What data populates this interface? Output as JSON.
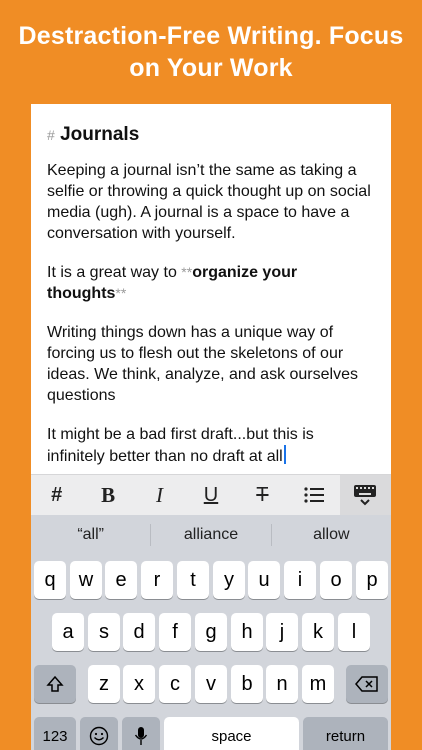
{
  "headline": {
    "line1": "Destraction-Free Writing.  Focus",
    "line2": "on Your Work"
  },
  "editor": {
    "heading_marker": "#",
    "heading": "Journals",
    "para1": "Keeping a journal isn’t the same as taking a selfie or throwing a quick thought up on social media (ugh).  A journal is a space to have a conversation with yourself.",
    "para2_pre": "It is a great way to ",
    "para2_mark": "**",
    "para2_bold": "organize your thoughts",
    "para3": "Writing things down has a unique way of forcing us to flesh out the skeletons of our ideas.  We think, analyze, and ask ourselves questions",
    "para4": "It might be a bad first draft...but this is infinitely better than no draft at all"
  },
  "toolbar": {
    "items": [
      {
        "label": "#",
        "icon": "heading-icon"
      },
      {
        "label": "B",
        "icon": "bold-icon"
      },
      {
        "label": "I",
        "icon": "italic-icon"
      },
      {
        "label": "U",
        "icon": "underline-icon"
      },
      {
        "label": "T",
        "icon": "strikethrough-icon"
      },
      {
        "icon": "list-icon"
      },
      {
        "icon": "keyboard-dismiss-icon"
      }
    ]
  },
  "keyboard": {
    "suggestions": [
      "“all”",
      "alliance",
      "allow"
    ],
    "row1": [
      "q",
      "w",
      "e",
      "r",
      "t",
      "y",
      "u",
      "i",
      "o",
      "p"
    ],
    "row2": [
      "a",
      "s",
      "d",
      "f",
      "g",
      "h",
      "j",
      "k",
      "l"
    ],
    "row3": [
      "z",
      "x",
      "c",
      "v",
      "b",
      "n",
      "m"
    ],
    "numbers_label": "123",
    "space_label": "space",
    "return_label": "return"
  },
  "colors": {
    "background": "#F08D25",
    "caret": "#1a73e8"
  }
}
